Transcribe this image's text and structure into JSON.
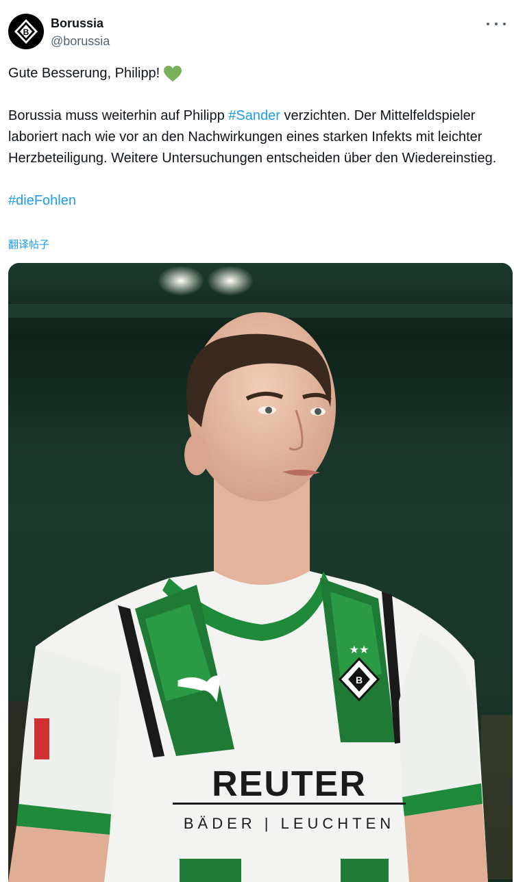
{
  "author": {
    "display_name": "Borussia",
    "handle": "@borussia",
    "avatar_icon": "borussia-crest-icon"
  },
  "tweet": {
    "line1": "Gute Besserung, Philipp!",
    "heart_color": "#78b159",
    "para_before": "Borussia muss weiterhin auf Philipp ",
    "hashtag_sander": "#Sander",
    "para_after": " verzichten. Der Mittelfeldspieler laboriert nach wie vor an den Nachwirkungen eines starken Infekts mit leichter Herzbeteiligung. Weitere Untersuchungen entscheiden über den Wiedereinstieg.",
    "hashtag_fohlen": "#dieFohlen",
    "translate_label": "翻译帖子"
  },
  "media": {
    "sponsor_main": "REUTER",
    "sponsor_sub": "BÄDER | LEUCHTEN"
  },
  "colors": {
    "link": "#1d9bf0",
    "text": "#0f1419",
    "muted": "#536471",
    "kit_green": "#1f8a3a"
  }
}
